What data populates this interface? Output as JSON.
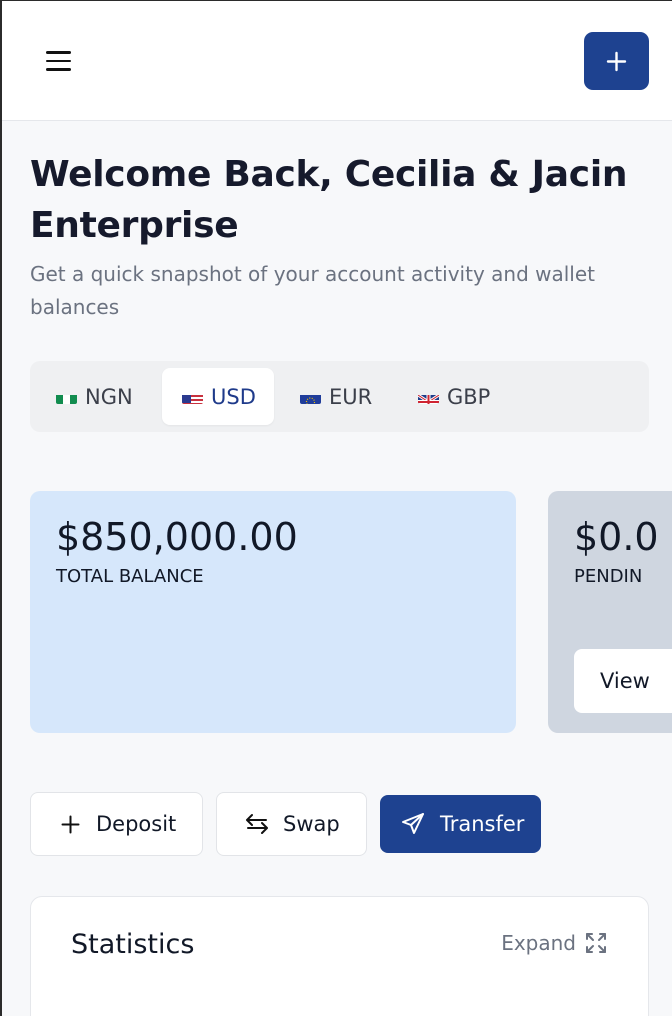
{
  "header": {
    "menu_icon": "hamburger-menu-icon",
    "add_icon": "plus-icon",
    "accent": "#1e4290"
  },
  "welcome": {
    "title": "Welcome Back, Cecilia & Jacin Enterprise",
    "subtitle": "Get a quick snapshot of your account activity and wallet balances"
  },
  "currency_tabs": [
    {
      "label": "NGN",
      "flag": "nigeria-flag-icon",
      "active": false
    },
    {
      "label": "USD",
      "flag": "us-flag-icon",
      "active": true
    },
    {
      "label": "EUR",
      "flag": "eu-flag-icon",
      "active": false
    },
    {
      "label": "GBP",
      "flag": "uk-flag-icon",
      "active": false
    }
  ],
  "balances": {
    "total": {
      "amount": "$850,000.00",
      "label": "TOTAL BALANCE",
      "color": "#d6e7fb"
    },
    "pending": {
      "amount": "$0.0",
      "label": "PENDIN",
      "button": "View",
      "color": "#cfd6e0"
    }
  },
  "actions": {
    "deposit": "Deposit",
    "swap": "Swap",
    "transfer": "Transfer"
  },
  "statistics": {
    "title": "Statistics",
    "expand": "Expand"
  }
}
